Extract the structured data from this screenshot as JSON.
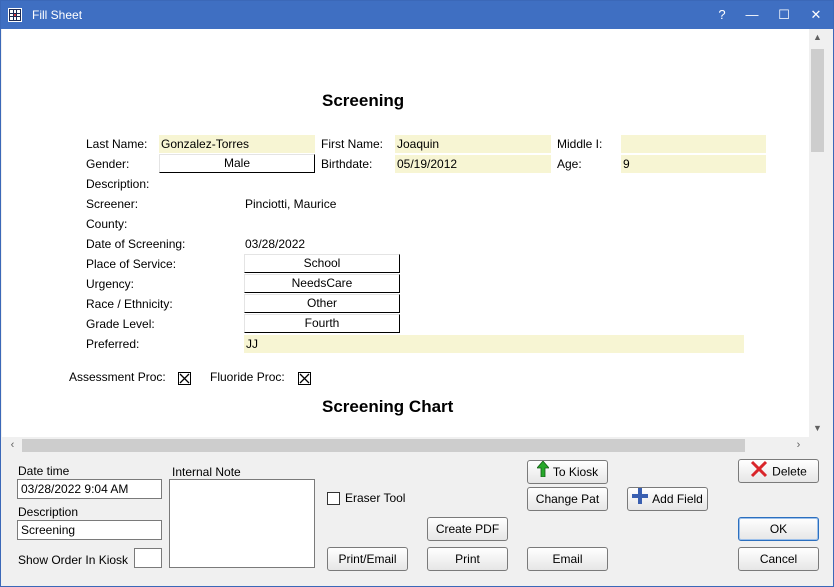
{
  "window": {
    "title": "Fill Sheet",
    "help": "?",
    "minimize": "—",
    "maximize": "☐",
    "close": "✕"
  },
  "sheet": {
    "heading": "Screening",
    "chart_heading": "Screening Chart",
    "labels": {
      "last_name": "Last Name:",
      "first_name": "First Name:",
      "middle_i": "Middle I:",
      "gender": "Gender:",
      "birthdate": "Birthdate:",
      "age": "Age:",
      "description": "Description:",
      "screener": "Screener:",
      "county": "County:",
      "date_of_screening": "Date of Screening:",
      "place_of_service": "Place of Service:",
      "urgency": "Urgency:",
      "race_ethnicity": "Race / Ethnicity:",
      "grade_level": "Grade Level:",
      "preferred": "Preferred:",
      "assessment_proc": "Assessment Proc:",
      "fluoride_proc": "Fluoride Proc:"
    },
    "values": {
      "last_name": "Gonzalez-Torres",
      "first_name": "Joaquin",
      "middle_i": "",
      "gender": "Male",
      "birthdate": "05/19/2012",
      "age": "9",
      "description": "",
      "screener": "Pinciotti, Maurice",
      "county": "",
      "date_of_screening": "03/28/2022",
      "place_of_service": "School",
      "urgency": "NeedsCare",
      "race_ethnicity": "Other",
      "grade_level": "Fourth",
      "preferred": "JJ",
      "assessment_proc_checked": true,
      "fluoride_proc_checked": true
    }
  },
  "scroll": {
    "up": "▲",
    "down": "▼",
    "left": "‹",
    "right": "›"
  },
  "bottom": {
    "date_time_label": "Date time",
    "date_time_value": "03/28/2022 9:04 AM",
    "description_label": "Description",
    "description_value": "Screening",
    "show_order_label": "Show Order In Kiosk",
    "show_order_value": "",
    "internal_note_label": "Internal Note",
    "internal_note_value": "",
    "eraser_tool_label": "Eraser Tool",
    "buttons": {
      "to_kiosk": "To Kiosk",
      "change_pat": "Change Pat",
      "add_field": "Add Field",
      "delete": "Delete",
      "create_pdf": "Create PDF",
      "print_email": "Print/Email",
      "print": "Print",
      "email": "Email",
      "ok": "OK",
      "cancel": "Cancel"
    }
  },
  "colors": {
    "titlebar": "#3f6fc2",
    "field_fill": "#f7f5d3",
    "delete_x": "#d9252a",
    "kiosk_arrow": "#27a82a",
    "add_plus": "#3a5fb0"
  }
}
